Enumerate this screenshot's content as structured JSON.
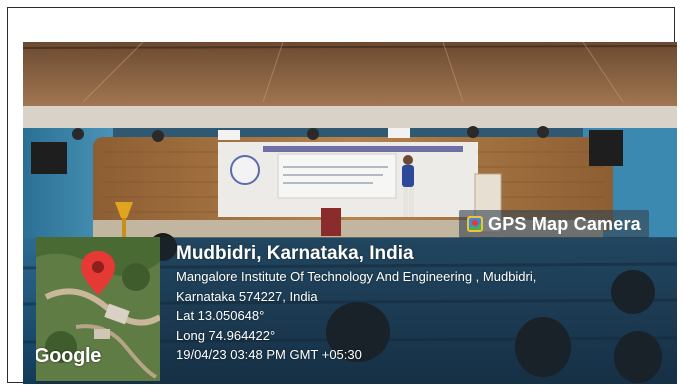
{
  "badge": {
    "label": "GPS Map Camera",
    "icon": "gps-map-camera-icon"
  },
  "location": {
    "title": "Mudbidri, Karnataka, India",
    "address_line1": "Mangalore Institute Of Technology And Engineering , Mudbidri,",
    "address_line2": "Karnataka 574227, India",
    "lat": "Lat 13.050648°",
    "long": "Long 74.964422°",
    "timestamp": "19/04/23 03:48 PM GMT +05:30"
  },
  "map": {
    "provider": "Google",
    "pin_icon": "map-pin-icon",
    "pin_color": "#e53935"
  },
  "colors": {
    "overlay": "#192837",
    "seat_blue": "#2f6d93",
    "stage_wood": "#a0703f"
  }
}
